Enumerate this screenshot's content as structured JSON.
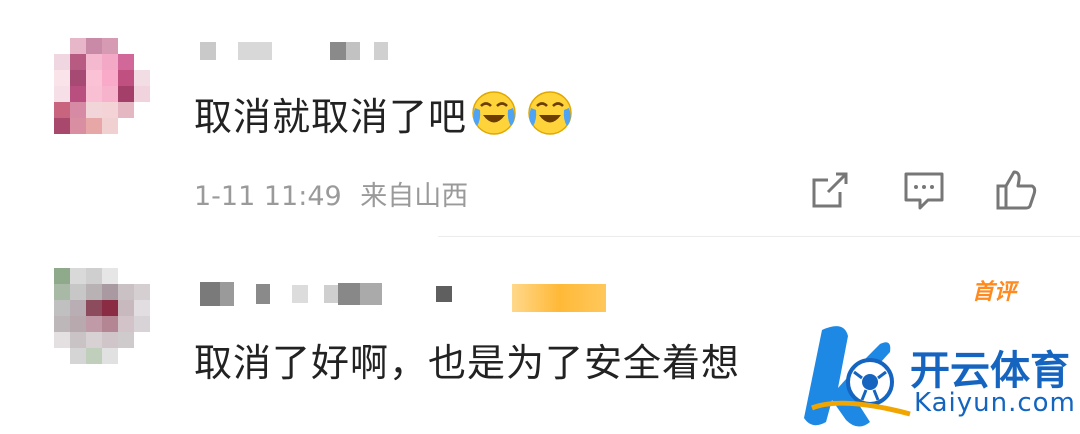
{
  "comments": [
    {
      "text": "取消就取消了吧",
      "emoji": [
        "laugh-cry-icon",
        "laugh-cry-icon"
      ],
      "time": "1-11 11:49",
      "location": "来自山西"
    },
    {
      "text": "取消了好啊，也是为了安全着想",
      "badge": "首评"
    }
  ],
  "actions": [
    "share-icon",
    "comment-icon",
    "like-icon"
  ],
  "watermark": {
    "title": "开云体育",
    "url": "Kaiyun.com"
  },
  "colors": {
    "text": "#222222",
    "meta": "#9a9a9a",
    "badge": "#ff8a1f",
    "watermark": "#1565c0"
  }
}
